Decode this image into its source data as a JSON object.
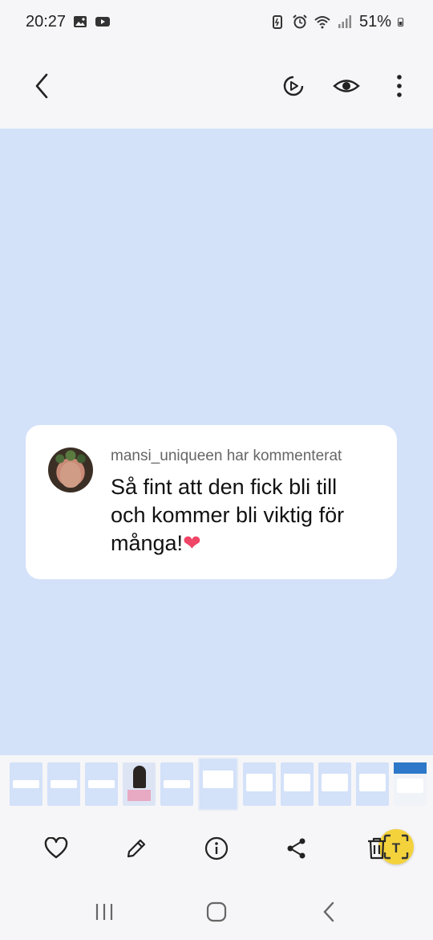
{
  "status_bar": {
    "time": "20:27",
    "battery": "51%"
  },
  "app_bar": {
    "back_icon": "chevron-left-icon",
    "icons": [
      "motion-photo-icon",
      "eye-icon",
      "more-vertical-icon"
    ]
  },
  "comment": {
    "user_line": "mansi_uniqueen har kommenterat",
    "text": "Så fint att den fick bli till och kommer bli viktig för många!",
    "emoji": "❤️"
  },
  "lens_button": {
    "label": "T"
  },
  "filmstrip": {
    "thumbnail_count": 11,
    "active_index": 5
  },
  "actions": [
    "heart-icon",
    "edit-pencil-icon",
    "info-icon",
    "share-icon",
    "trash-icon"
  ],
  "navigation": [
    "recent-apps-icon",
    "home-icon",
    "back-icon"
  ],
  "colors": {
    "viewer_background": "#d3e1f9",
    "card": "#ffffff",
    "lens_accent": "#f4d23c"
  }
}
